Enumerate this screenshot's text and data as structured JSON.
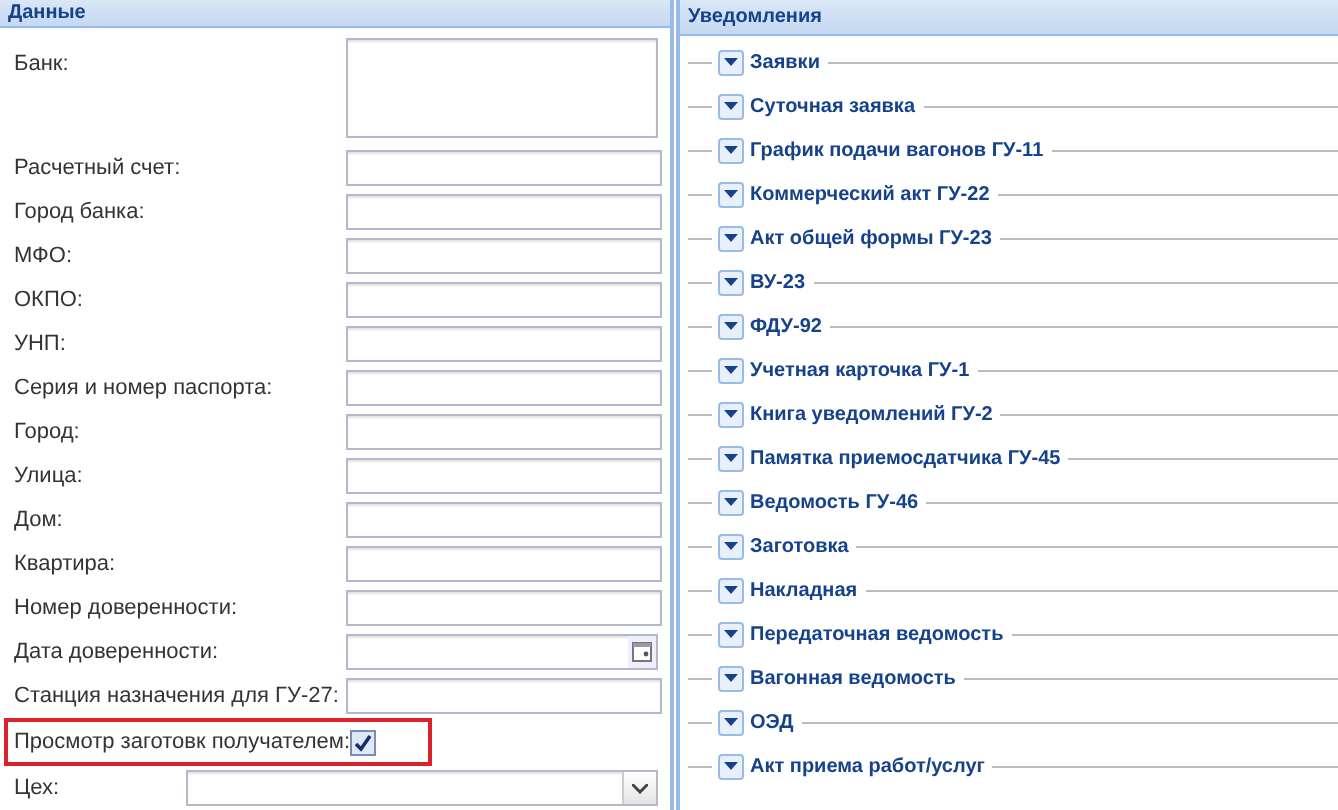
{
  "data_panel": {
    "title": "Данные",
    "fields": [
      {
        "label": "Банк:",
        "kind": "textarea"
      },
      {
        "label": "Расчетный счет:",
        "kind": "text"
      },
      {
        "label": "Город банка:",
        "kind": "text"
      },
      {
        "label": "МФО:",
        "kind": "text"
      },
      {
        "label": "ОКПО:",
        "kind": "text"
      },
      {
        "label": "УНП:",
        "kind": "text"
      },
      {
        "label": "Серия и номер паспорта:",
        "kind": "text"
      },
      {
        "label": "Город:",
        "kind": "text"
      },
      {
        "label": "Улица:",
        "kind": "text"
      },
      {
        "label": "Дом:",
        "kind": "text"
      },
      {
        "label": "Квартира:",
        "kind": "text"
      },
      {
        "label": "Номер доверенности:",
        "kind": "text"
      },
      {
        "label": "Дата доверенности:",
        "kind": "date"
      },
      {
        "label": "Станция назначения для ГУ-27:",
        "kind": "text"
      },
      {
        "label": "Просмотр заготовк получателем:",
        "kind": "checkbox",
        "checked": true,
        "highlighted": true
      },
      {
        "label": "Цех:",
        "kind": "select"
      }
    ]
  },
  "notifications_panel": {
    "title": "Уведомления",
    "groups": [
      "Заявки",
      "Суточная заявка",
      "График подачи вагонов ГУ-11",
      "Коммерческий акт ГУ-22",
      "Акт общей формы ГУ-23",
      "ВУ-23",
      "ФДУ-92",
      "Учетная карточка ГУ-1",
      "Книга уведомлений ГУ-2",
      "Памятка приемосдатчика ГУ-45",
      "Ведомость ГУ-46",
      "Заготовка",
      "Накладная",
      "Передаточная ведомость",
      "Вагонная ведомость",
      "ОЭД",
      "Акт приема работ/услуг"
    ]
  }
}
